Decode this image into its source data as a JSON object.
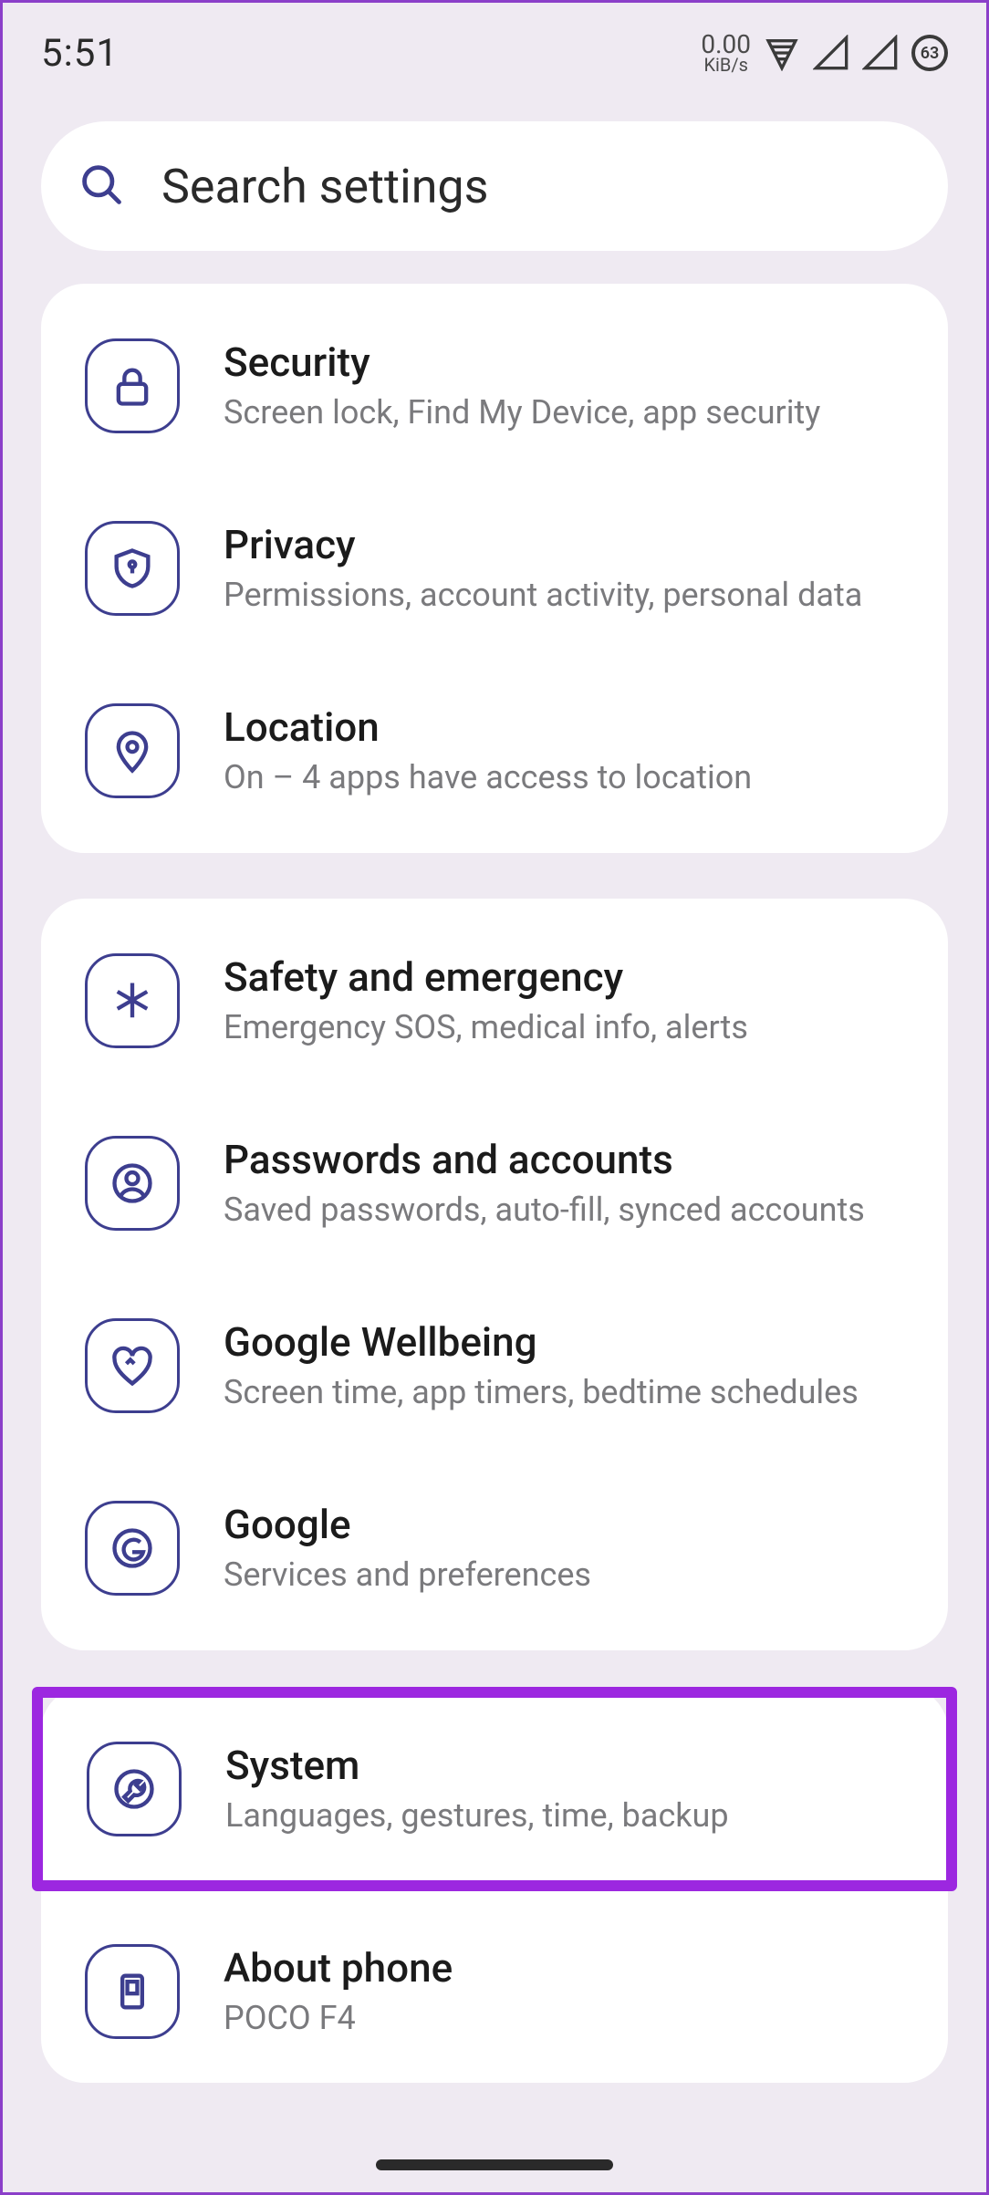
{
  "status_bar": {
    "time": "5:51",
    "net_speed_value": "0.00",
    "net_speed_unit": "KiB/s",
    "battery_pct": "63"
  },
  "search": {
    "placeholder": "Search settings"
  },
  "groups": [
    {
      "rows": [
        {
          "icon": "lock",
          "title": "Security",
          "subtitle": "Screen lock, Find My Device, app security"
        },
        {
          "icon": "shield",
          "title": "Privacy",
          "subtitle": "Permissions, account activity, personal data"
        },
        {
          "icon": "pin",
          "title": "Location",
          "subtitle": "On – 4 apps have access to location"
        }
      ]
    },
    {
      "rows": [
        {
          "icon": "asterisk",
          "title": "Safety and emergency",
          "subtitle": "Emergency SOS, medical info, alerts"
        },
        {
          "icon": "person",
          "title": "Passwords and accounts",
          "subtitle": "Saved passwords, auto-fill, synced accounts"
        },
        {
          "icon": "heart",
          "title": "Google Wellbeing",
          "subtitle": "Screen time, app timers, bedtime schedules"
        },
        {
          "icon": "g",
          "title": "Google",
          "subtitle": "Services and preferences"
        }
      ]
    },
    {
      "rows": [
        {
          "icon": "wrench",
          "title": "System",
          "subtitle": "Languages, gestures, time, backup",
          "highlighted": true
        },
        {
          "icon": "phone",
          "title": "About phone",
          "subtitle": "POCO F4"
        }
      ]
    }
  ]
}
